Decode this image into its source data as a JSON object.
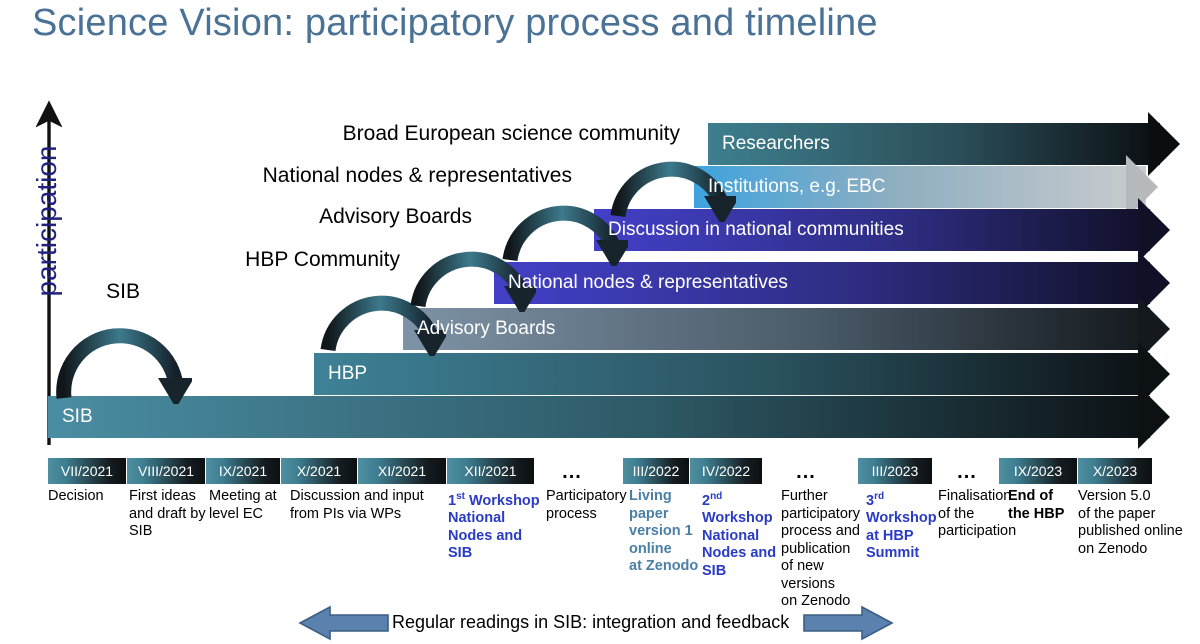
{
  "title": "Science Vision: participatory process and timeline",
  "axis": {
    "label": "participation",
    "icon": "up-arrow-axis-icon"
  },
  "colors": {
    "title": "#4A7296",
    "axis_label": "#202080",
    "bar_sib": "#4A8DA2",
    "bar_hbp": "#3E8196",
    "bar_advisory": "#7E93A6",
    "bar_national": "#4340C8",
    "bar_discussion": "#4340C8",
    "bar_institutions": "#3FA3DE",
    "bar_researchers": "#3D7E8C",
    "timeline_block": "#3E7E91",
    "footer_arrow": "#5B82AE",
    "caption_blue": "#2A3BC4",
    "caption_teal": "#4A7FA6"
  },
  "level_labels": [
    {
      "text": "Broad European science community"
    },
    {
      "text": "National nodes & representatives"
    },
    {
      "text": "Advisory Boards"
    },
    {
      "text": "HBP Community"
    },
    {
      "text": "SIB"
    }
  ],
  "bars": [
    {
      "name": "researchers",
      "label": "Researchers"
    },
    {
      "name": "institutions",
      "label": "Institutions, e.g. EBC"
    },
    {
      "name": "discussion",
      "label": "Discussion in national communities"
    },
    {
      "name": "national-nodes",
      "label": "National nodes & representatives"
    },
    {
      "name": "advisory",
      "label": "Advisory Boards"
    },
    {
      "name": "hbp",
      "label": "HBP"
    },
    {
      "name": "sib",
      "label": "SIB"
    }
  ],
  "timeline": {
    "blocks": [
      {
        "label": "VII/2021"
      },
      {
        "label": "VIII/2021"
      },
      {
        "label": "IX/2021"
      },
      {
        "label": "X/2021"
      },
      {
        "label": "XI/2021"
      },
      {
        "label": "XII/2021"
      },
      {
        "label": "III/2022"
      },
      {
        "label": "IV/2022"
      },
      {
        "label": "III/2023"
      },
      {
        "label": "IX/2023"
      },
      {
        "label": "X/2023"
      }
    ],
    "ellipses": [
      "...",
      "...",
      "..."
    ],
    "captions": [
      {
        "style": "plain",
        "lines": [
          "Decision"
        ]
      },
      {
        "style": "plain",
        "lines": [
          "First ideas",
          "and draft by",
          "SIB"
        ]
      },
      {
        "style": "plain",
        "lines": [
          "Meeting at",
          "level EC"
        ]
      },
      {
        "style": "plain",
        "lines": [
          "Discussion and input",
          "from PIs via WPs"
        ]
      },
      {
        "style": "blue",
        "lines": [
          "1st Workshop",
          "National",
          "Nodes and",
          "SIB"
        ],
        "sup": "st"
      },
      {
        "style": "plain",
        "lines": [
          "Participatory",
          "process"
        ]
      },
      {
        "style": "teal",
        "lines": [
          "Living",
          "paper",
          "version 1",
          "online",
          "at Zenodo"
        ]
      },
      {
        "style": "blue",
        "lines": [
          "2nd",
          "Workshop",
          "National",
          "Nodes and",
          "SIB"
        ],
        "sup": "nd"
      },
      {
        "style": "plain",
        "lines": [
          "Further",
          "participatory",
          "process and",
          "publication",
          "of new versions",
          "on Zenodo"
        ]
      },
      {
        "style": "blue",
        "lines": [
          "3rd",
          "Workshop",
          "at HBP",
          "Summit"
        ],
        "sup": "rd"
      },
      {
        "style": "plain",
        "lines": [
          "Finalisation",
          "of the",
          "participation"
        ]
      },
      {
        "style": "bold",
        "lines": [
          "End of",
          "the HBP"
        ]
      },
      {
        "style": "plain",
        "lines": [
          "Version 5.0",
          "of the paper",
          "published online",
          "on Zenodo"
        ]
      }
    ]
  },
  "footer": {
    "text": "Regular readings in SIB: integration and feedback",
    "left_arrow_icon": "arrow-left-icon",
    "right_arrow_icon": "arrow-right-icon"
  }
}
